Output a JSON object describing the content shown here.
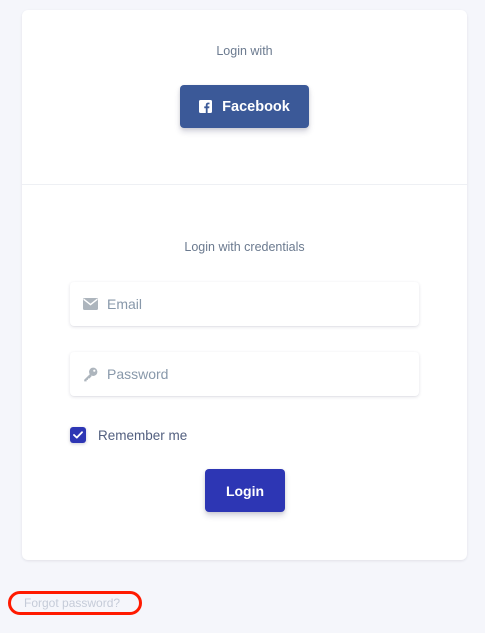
{
  "social": {
    "title": "Login with",
    "facebook_label": "Facebook",
    "facebook_color": "#3b5998"
  },
  "credentials": {
    "title": "Login with credentials",
    "email": {
      "placeholder": "Email",
      "value": "",
      "icon": "envelope-icon"
    },
    "password": {
      "placeholder": "Password",
      "value": "",
      "icon": "key-icon"
    },
    "remember": {
      "label": "Remember me",
      "checked": true
    }
  },
  "actions": {
    "login_label": "Login",
    "login_color": "#2d36b4"
  },
  "footer": {
    "forgot_label": "Forgot password?",
    "highlight_color": "#ff1a00"
  }
}
